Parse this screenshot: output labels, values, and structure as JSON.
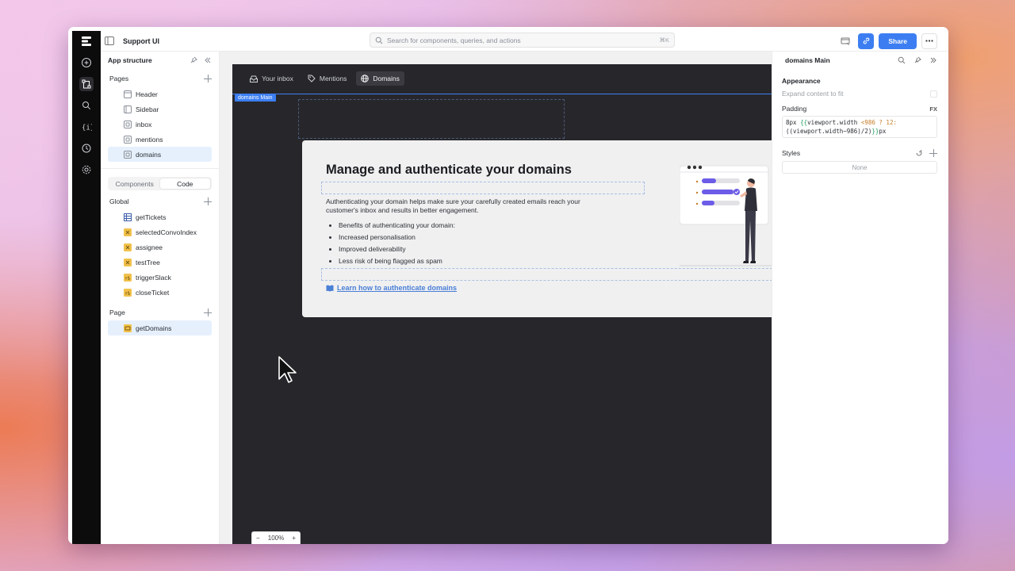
{
  "topbar": {
    "app_title": "Support UI",
    "search_placeholder": "Search for components, queries, and actions",
    "search_shortcut": "⌘K",
    "share_label": "Share"
  },
  "left_panel": {
    "title": "App structure",
    "pages_label": "Pages",
    "pages": [
      {
        "label": "Header",
        "icon": "header-icon"
      },
      {
        "label": "Sidebar",
        "icon": "sidebar-icon"
      },
      {
        "label": "inbox",
        "icon": "page-icon"
      },
      {
        "label": "mentions",
        "icon": "page-icon"
      },
      {
        "label": "domains",
        "icon": "page-icon",
        "selected": true
      }
    ],
    "tabs": {
      "components": "Components",
      "code": "Code"
    },
    "global_label": "Global",
    "global_items": [
      {
        "label": "getTickets",
        "icon": "table-icon"
      },
      {
        "label": "selectedConvoIndex",
        "icon": "variable-icon"
      },
      {
        "label": "assignee",
        "icon": "variable-icon"
      },
      {
        "label": "testTree",
        "icon": "variable-icon"
      },
      {
        "label": "triggerSlack",
        "icon": "js-icon"
      },
      {
        "label": "closeTicket",
        "icon": "js-icon"
      }
    ],
    "page_label": "Page",
    "page_items": [
      {
        "label": "getDomains",
        "icon": "query-icon",
        "selected": true
      }
    ]
  },
  "canvas": {
    "nav": {
      "inbox": "Your inbox",
      "mentions": "Mentions",
      "domains": "Domains"
    },
    "selection_tag": "domains Main",
    "card": {
      "title": "Manage and authenticate your domains",
      "description": "Authenticating your domain helps make sure your carefully created emails reach your customer's inbox and results in better engagement.",
      "benefits": [
        "Benefits of authenticating your domain:",
        "Increased personalisation",
        "Improved deliverability",
        "Less risk of being flagged as spam"
      ],
      "link": "Learn how to authenticate domains"
    },
    "zoom": {
      "minus": "−",
      "level": "100%",
      "plus": "+"
    }
  },
  "right_panel": {
    "title": "domains Main",
    "appearance_label": "Appearance",
    "expand_label": "Expand content to fit",
    "padding_label": "Padding",
    "fx_label": "FX",
    "padding_code": {
      "line1_a": "8px ",
      "line1_b": "{{",
      "line1_c": "viewport.width ",
      "line1_d": "<986 ? 12:",
      "line2_a": "((viewport.width−986)/2)",
      "line2_b": "}}",
      "line2_c": "px"
    },
    "styles_label": "Styles",
    "styles_value": "None"
  },
  "colors": {
    "accent": "#3c7ef2",
    "canvas_dark": "#27272b",
    "selected_bg": "#e6f0fd",
    "illustration_purple": "#6c5ce7"
  }
}
